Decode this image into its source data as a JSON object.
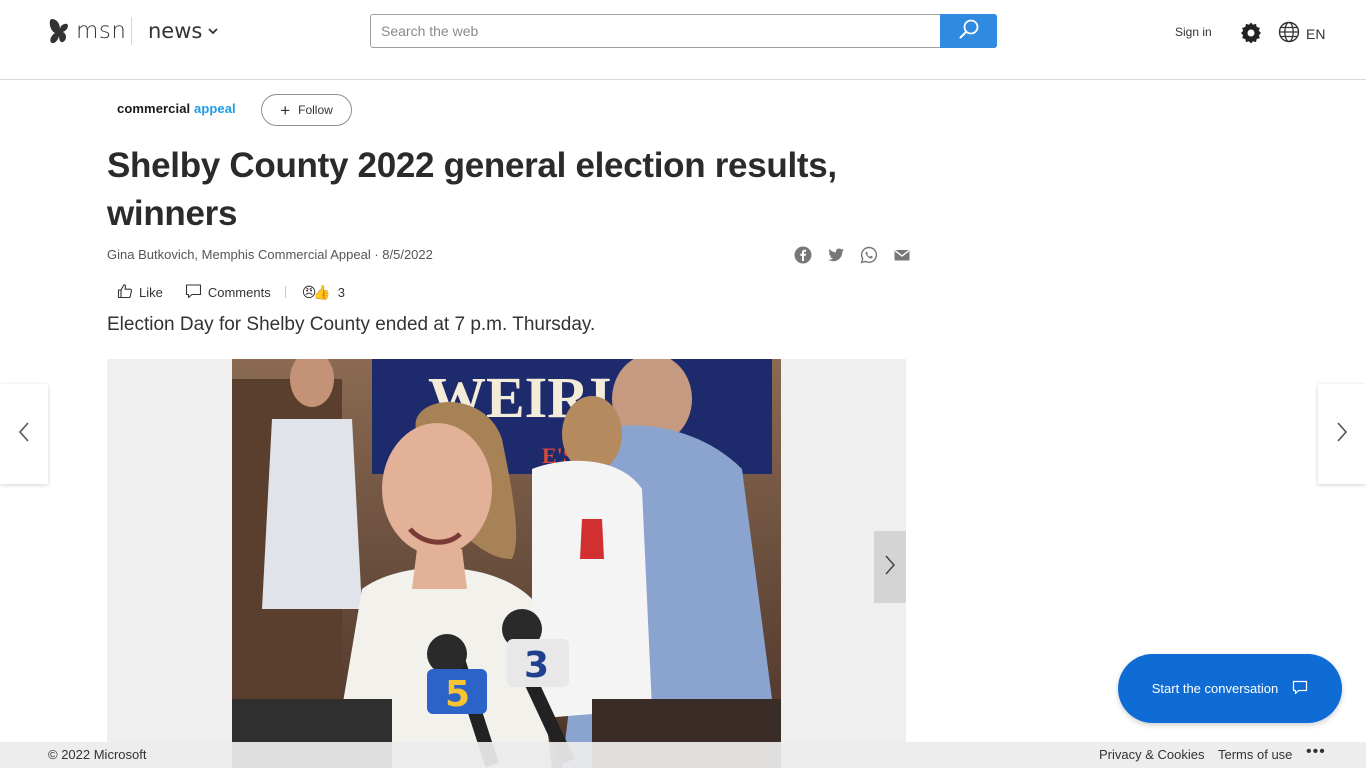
{
  "header": {
    "logo_text": "msn",
    "section_label": "news",
    "search": {
      "placeholder": "Search the web",
      "value": ""
    },
    "sign_in_label": "Sign in",
    "language_label": "EN",
    "accent_color": "#2f8ae0"
  },
  "publisher": {
    "name_part1": "commercial",
    "name_part2": "appeal",
    "follow_plus": "+",
    "follow_label": "Follow"
  },
  "article": {
    "title": "Shelby County 2022 general election results, winners",
    "byline": "Gina Butkovich, Memphis Commercial Appeal · 8/5/2022",
    "share_icons": [
      "facebook-icon",
      "twitter-icon",
      "whatsapp-icon",
      "email-icon"
    ],
    "like_label": "Like",
    "comments_label": "Comments",
    "reaction_emoji": "😠👍",
    "reaction_count": "3",
    "lead": "Election Day for Shelby County ended at 7 p.m. Thursday."
  },
  "photo": {
    "sign_text": "WEIRIC",
    "sign_subtext": "E'S OF",
    "mic_numbers": [
      "5",
      "3"
    ]
  },
  "conversation": {
    "label": "Start the conversation",
    "color": "#0f6cd4"
  },
  "footer": {
    "copyright": "© 2022 Microsoft",
    "privacy_label": "Privacy & Cookies",
    "terms_label": "Terms of use",
    "more_label": "•••"
  }
}
